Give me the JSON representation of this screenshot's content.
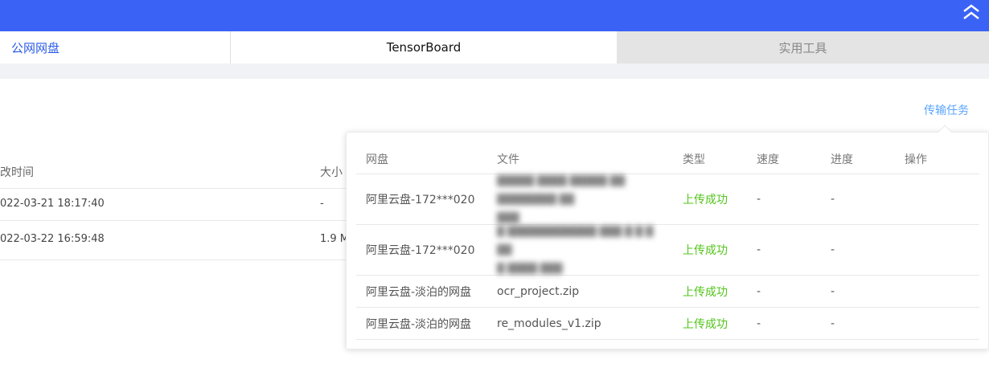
{
  "tabs": [
    {
      "label": "公网网盘"
    },
    {
      "label": "TensorBoard"
    },
    {
      "label": "实用工具"
    }
  ],
  "transfer_link": "传输任务",
  "background_table": {
    "headers": [
      "改时间",
      "大小"
    ],
    "rows": [
      {
        "time": "022-03-21 18:17:40",
        "size": "-"
      },
      {
        "time": "022-03-22 16:59:48",
        "size": "1.9 M"
      }
    ]
  },
  "transfer_popup": {
    "headers": [
      "网盘",
      "文件",
      "类型",
      "速度",
      "进度",
      "操作"
    ],
    "rows": [
      {
        "disk": "阿里云盘-172***020",
        "file": "",
        "type": "上传成功",
        "speed": "-",
        "progress": "-"
      },
      {
        "disk": "阿里云盘-172***020",
        "file": "",
        "type": "上传成功",
        "speed": "-",
        "progress": "-"
      },
      {
        "disk": "阿里云盘-淡泊的网盘",
        "file": "ocr_project.zip",
        "type": "上传成功",
        "speed": "-",
        "progress": "-"
      },
      {
        "disk": "阿里云盘-淡泊的网盘",
        "file": "re_modules_v1.zip",
        "type": "上传成功",
        "speed": "-",
        "progress": "-"
      }
    ]
  },
  "colors": {
    "topbar": "#3a63f5",
    "accent": "#2b5be8",
    "success": "#52c41a",
    "link": "#59a4ff"
  }
}
